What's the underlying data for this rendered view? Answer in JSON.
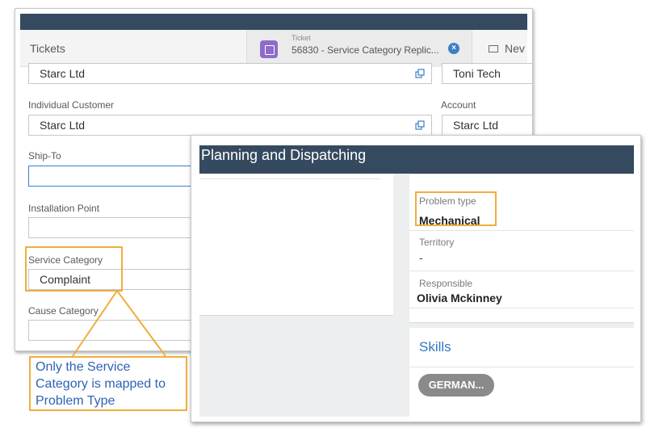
{
  "ticket_window": {
    "tabs": {
      "tickets_label": "Tickets",
      "active_kind": "Ticket",
      "active_title": "56830 - Service Category Replic...",
      "close_symbol": "×",
      "new_label": "Nev"
    },
    "fields": {
      "top_customer_value": "Starc Ltd",
      "top_right_value": "Toni Tech",
      "individual_customer_label": "Individual Customer",
      "individual_customer_value": "Starc Ltd",
      "account_label": "Account",
      "account_value": "Starc Ltd",
      "ship_to_label": "Ship-To",
      "ship_to_value": "",
      "installation_point_label": "Installation Point",
      "installation_point_value": "",
      "service_category_label": "Service Category",
      "service_category_value": "Complaint",
      "cause_category_label": "Cause Category",
      "cause_category_value": ""
    }
  },
  "planning_window": {
    "header": "Planning and Dispatching",
    "problem_type_label": "Problem type",
    "problem_type_value": "Mechanical",
    "territory_label": "Territory",
    "territory_value": "-",
    "responsible_label": "Responsible",
    "responsible_value": "Olivia Mckinney",
    "skills_title": "Skills",
    "skills": [
      "GERMAN..."
    ]
  },
  "annotation": {
    "callout_text": "Only the Service Category is mapped to Problem Type",
    "highlight_color": "#f0ad3c"
  },
  "colors": {
    "header_bar": "#354a5f",
    "link_blue": "#2f79c4",
    "ticket_icon": "#8e6bc8",
    "close_icon": "#3d7fc4"
  },
  "icons": [
    "ticket-icon",
    "close-icon",
    "grid-icon",
    "open-link-icon"
  ]
}
